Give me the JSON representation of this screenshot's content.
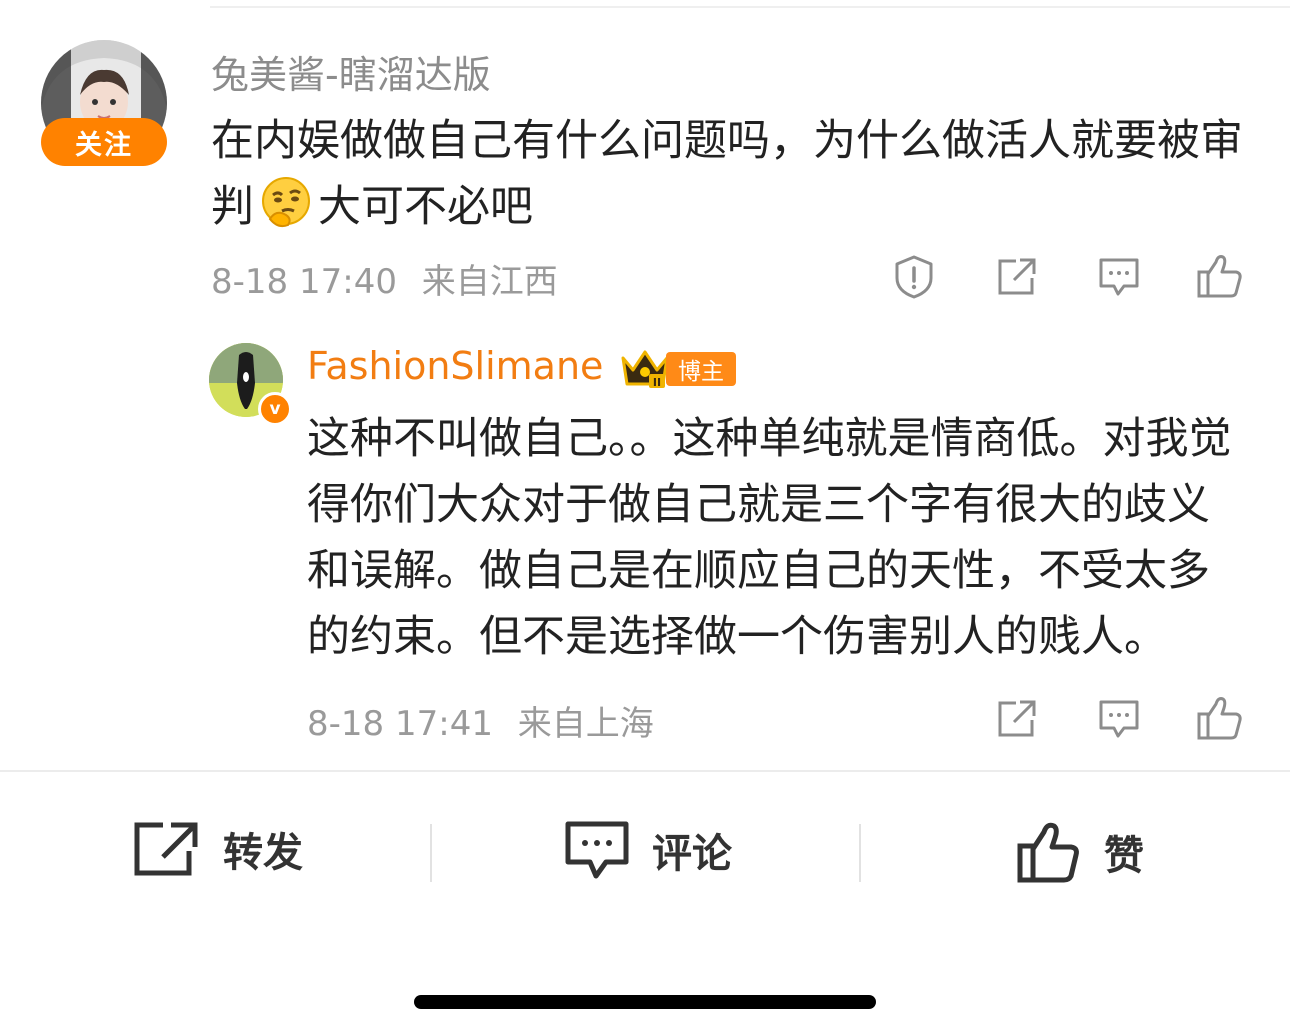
{
  "comment": {
    "username": "兔美酱-瞎溜达版",
    "follow_label": "关注",
    "text_part1": "在内娱做做自己有什么问题吗，为什么做活人就要被审判",
    "text_part2": "大可不必吧",
    "timestamp": "8-18 17:40",
    "location": "来自江西"
  },
  "reply": {
    "username": "FashionSlimane",
    "badge_label": "博主",
    "verified_mark": "v",
    "text": "这种不叫做自己。。这种单纯就是情商低。对我觉得你们大众对于做自己就是三个字有很大的歧义和误解。做自己是在顺应自己的天性，不受太多的约束。但不是选择做一个伤害别人的贱人。",
    "timestamp": "8-18 17:41",
    "location": "来自上海"
  },
  "bottom_bar": {
    "repost_label": "转发",
    "comment_label": "评论",
    "like_label": "赞"
  },
  "colors": {
    "accent_orange": "#ff8200",
    "blogger_name": "#f27d12",
    "meta_gray": "#9a9a9a"
  },
  "icons": [
    "report-icon",
    "share-icon",
    "comment-icon",
    "like-icon",
    "crown-icon",
    "thinking-emoji"
  ]
}
